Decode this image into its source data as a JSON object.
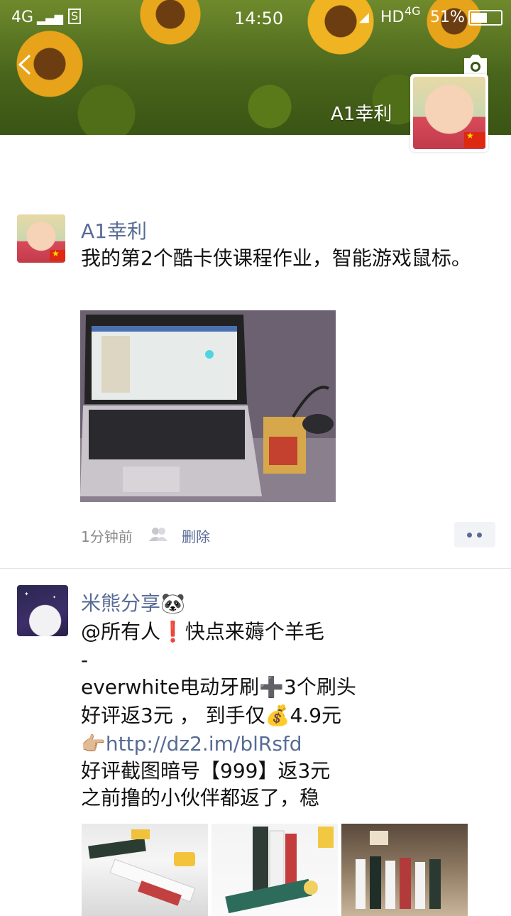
{
  "status_bar": {
    "network_left": "4G",
    "time": "14:50",
    "hd": "HD",
    "network_right": "4G",
    "battery": "51%"
  },
  "cover": {
    "user_name": "A1幸利"
  },
  "posts": [
    {
      "author": "A1幸利",
      "text": "我的第2个酷卡侠课程作业，智能游戏鼠标。",
      "time": "1分钟前",
      "delete_label": "删除"
    },
    {
      "author": "米熊分享🐼",
      "lines": [
        "@所有人❗快点来薅个羊毛",
        "-",
        "everwhite电动牙刷➕3个刷头",
        "好评返3元 ， 到手仅💰4.9元",
        "👉🏼http://dz2.im/blRsfd",
        "好评截图暗号【999】返3元",
        "之前撸的小伙伴都返了，稳"
      ]
    }
  ],
  "colors": {
    "link": "#576b95",
    "text": "#111111",
    "meta": "#8a8a8a"
  }
}
